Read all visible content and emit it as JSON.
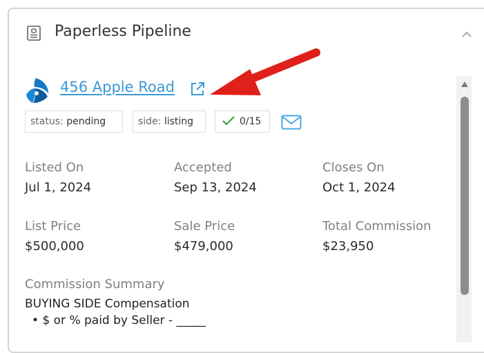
{
  "header": {
    "title": "Paperless Pipeline",
    "icon": "document-icon"
  },
  "listing": {
    "address": "456 Apple Road",
    "tags": {
      "status_key": "status:",
      "status_value": "pending",
      "side_key": "side:",
      "side_value": "listing",
      "tasks": "0/15"
    }
  },
  "fields": {
    "listed_on": {
      "label": "Listed On",
      "value": "Jul 1, 2024"
    },
    "accepted": {
      "label": "Accepted",
      "value": "Sep 13, 2024"
    },
    "closes_on": {
      "label": "Closes On",
      "value": "Oct 1, 2024"
    },
    "list_price": {
      "label": "List Price",
      "value": "$500,000"
    },
    "sale_price": {
      "label": "Sale Price",
      "value": "$479,000"
    },
    "total_commission": {
      "label": "Total Commission",
      "value": "$23,950"
    }
  },
  "commission": {
    "label": "Commission Summary",
    "heading": "BUYING SIDE Compensation",
    "line": "• $ or % paid by Seller - _____"
  },
  "colors": {
    "link": "#3b98d6",
    "arrow": "#e0201b",
    "check": "#2e9e3a",
    "mail": "#4aa8e6"
  }
}
